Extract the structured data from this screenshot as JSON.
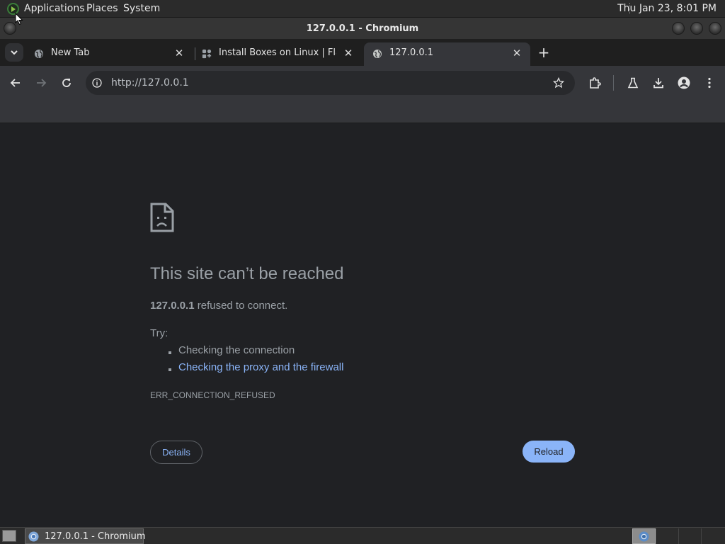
{
  "top_panel": {
    "menus": [
      "Applications",
      "Places",
      "System"
    ],
    "clock": "Thu Jan 23,  8:01 PM"
  },
  "window": {
    "title": "127.0.0.1 - Chromium"
  },
  "tabs": [
    {
      "title": "New Tab",
      "active": false
    },
    {
      "title": "Install Boxes on Linux | Flathub",
      "active": false
    },
    {
      "title": "127.0.0.1",
      "active": true
    }
  ],
  "tab_close_glyph": "✕",
  "new_tab_glyph": "+",
  "toolbar": {
    "url": "http://127.0.0.1"
  },
  "error_page": {
    "heading": "This site can’t be reached",
    "host": "127.0.0.1",
    "message": " refused to connect.",
    "try_label": "Try:",
    "suggestions": [
      "Checking the connection",
      "Checking the proxy and the firewall"
    ],
    "error_code": "ERR_CONNECTION_REFUSED",
    "details_label": "Details",
    "reload_label": "Reload"
  },
  "taskbar": {
    "item_label": "127.0.0.1 - Chromium"
  },
  "colors": {
    "page_bg": "#202124",
    "link": "#8ab4f8",
    "muted_text": "#9aa0a6",
    "reload_bg": "#8ab4f8"
  }
}
